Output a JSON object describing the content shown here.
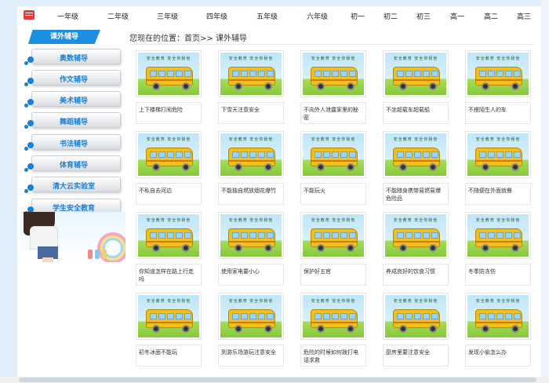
{
  "nav": {
    "home_icon": "book-icon",
    "grades": [
      "一年级",
      "二年级",
      "三年级",
      "四年级",
      "五年级",
      "六年级",
      "初一",
      "初二",
      "初三",
      "高一",
      "高二",
      "高三"
    ]
  },
  "sidebar": {
    "title": "课外辅导",
    "items": [
      "奥数辅导",
      "作文辅导",
      "美术辅导",
      "舞蹈辅导",
      "书法辅导",
      "体育辅导",
      "清大云实验室",
      "学生安全教育"
    ]
  },
  "breadcrumb": {
    "prefix": "您现在的位置：",
    "home": "首页",
    "sep": ">>",
    "current": "课外辅导"
  },
  "thumb_slogan": "安全教育  安全你我他",
  "cards": [
    "上下楼梯打闹危险",
    "下雪天注意安全",
    "不向外人泄露家里的秘密",
    "不坐超载车超载船",
    "不搭陌生人的车",
    "不私自去河边",
    "不能独自燃放烟花爆竹",
    "不能玩火",
    "不能随身携带易燃易爆危险品",
    "不随便在外面就餐",
    "你知道怎样在路上行走吗",
    "使用家电要小心",
    "保护好五官",
    "养成良好的饮食习惯",
    "冬季防冻伤",
    "初冬冰面不能玩",
    "到游乐场游玩注意安全",
    "危险的时候如何拨打电话求救",
    "厨房里要注意安全",
    "发现小偷怎么办"
  ],
  "colors": {
    "accent": "#1c8fe3",
    "sidebar_text": "#1c7fd6",
    "bus": "#f2bf1c"
  }
}
